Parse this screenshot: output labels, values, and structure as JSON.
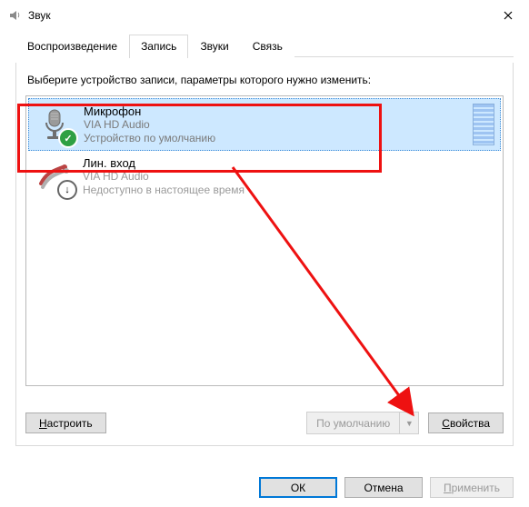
{
  "window": {
    "title": "Звук"
  },
  "tabs": {
    "t0": "Воспроизведение",
    "t1": "Запись",
    "t2": "Звуки",
    "t3": "Связь",
    "active": 1
  },
  "instruction": "Выберите устройство записи, параметры которого нужно изменить:",
  "devices": [
    {
      "name": "Микрофон",
      "driver": "VIA HD Audio",
      "status": "Устройство по умолчанию",
      "selected": true,
      "state": "default"
    },
    {
      "name": "Лин. вход",
      "driver": "VIA HD Audio",
      "status": "Недоступно в настоящее время",
      "selected": false,
      "state": "unavailable"
    }
  ],
  "buttons": {
    "configure": "Настроить",
    "configure_u": "Н",
    "set_default": "По умолчанию",
    "properties": "Свойства",
    "properties_u": "С",
    "ok": "ОК",
    "cancel": "Отмена",
    "apply": "Применить",
    "apply_u": "П"
  },
  "annotation": {
    "highlight_device_index": 0,
    "arrow_to": "properties"
  }
}
